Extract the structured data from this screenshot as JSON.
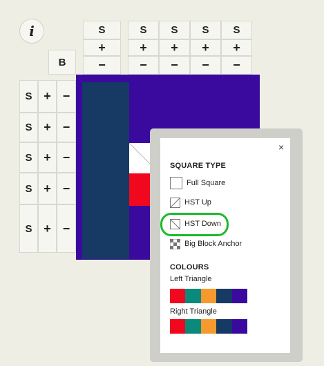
{
  "info_label": "i",
  "block_label": "B",
  "column_controls": [
    {
      "size": "S",
      "add": "+",
      "remove": "−"
    },
    {
      "size": "S",
      "add": "+",
      "remove": "−"
    },
    {
      "size": "S",
      "add": "+",
      "remove": "−"
    },
    {
      "size": "S",
      "add": "+",
      "remove": "−"
    },
    {
      "size": "S",
      "add": "+",
      "remove": "−"
    }
  ],
  "row_controls": [
    {
      "size": "S",
      "add": "+",
      "remove": "−"
    },
    {
      "size": "S",
      "add": "+",
      "remove": "−"
    },
    {
      "size": "S",
      "add": "+",
      "remove": "−"
    },
    {
      "size": "S",
      "add": "+",
      "remove": "−"
    },
    {
      "size": "S",
      "add": "+",
      "remove": "−"
    }
  ],
  "popup": {
    "close": "×",
    "square_type_heading": "SQUARE TYPE",
    "options": [
      {
        "label": "Full Square",
        "icon": "full-square-icon"
      },
      {
        "label": "HST Up",
        "icon": "hst-up-icon"
      },
      {
        "label": "HST Down",
        "icon": "hst-down-icon"
      },
      {
        "label": "Big Block Anchor",
        "icon": "checker-icon"
      }
    ],
    "colours_heading": "COLOURS",
    "left_triangle_label": "Left Triangle",
    "right_triangle_label": "Right Triangle"
  },
  "palette": [
    "#f0081f",
    "#0b8a7c",
    "#f79a2e",
    "#163a63",
    "#3a0a9e"
  ],
  "colors": {
    "background": "#eeeee4",
    "navy": "#163a63",
    "purple": "#3a0a9e",
    "red": "#f0081f",
    "highlight": "#1db92d"
  }
}
